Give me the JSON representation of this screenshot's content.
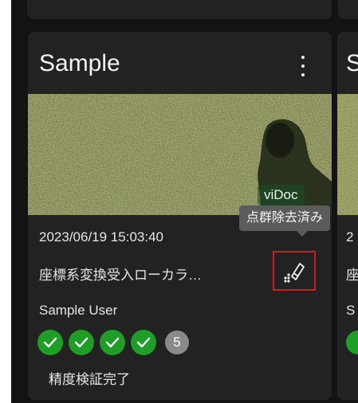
{
  "card": {
    "title": "Sample",
    "image_badge": "viDoc",
    "date": "2023/06/19 15:03:40",
    "description": "座標系変換受入ローカラ…",
    "user": "Sample User",
    "check_count": 4,
    "extra_count": "5",
    "status": "精度検証完了"
  },
  "tooltip": {
    "text": "点群除去済み"
  },
  "next_card": {
    "title_fragment": "S",
    "date_fragment": "2",
    "description_fragment": "座",
    "user_fragment": "S"
  },
  "icons": {
    "menu": "more-vertical-icon",
    "tool": "eraser-points-icon",
    "check": "check-icon"
  },
  "colors": {
    "background": "#131313",
    "card": "#222222",
    "check_green": "#1e9e27",
    "highlight_red": "#d21c1c",
    "tooltip": "#5b5b5b"
  }
}
